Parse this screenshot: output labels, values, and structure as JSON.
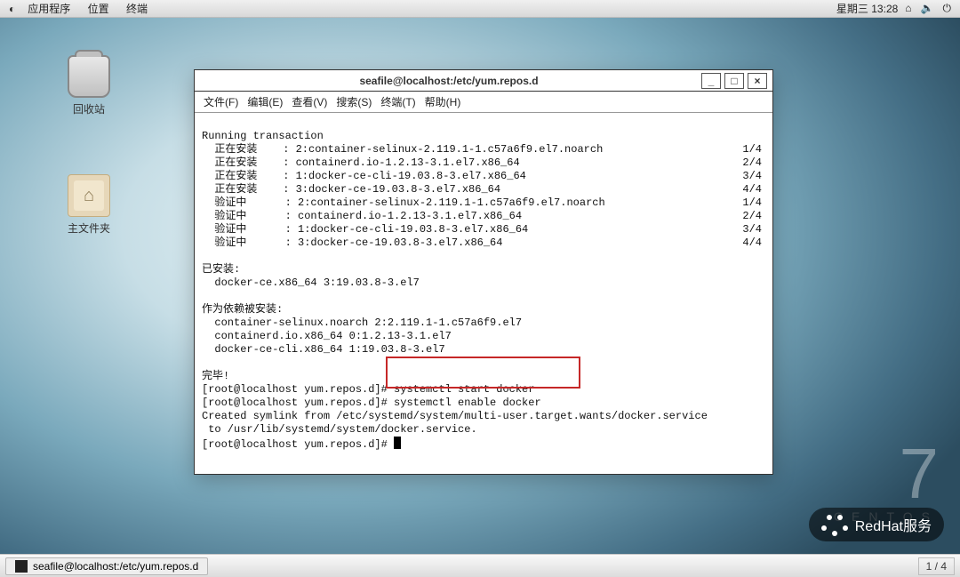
{
  "panel": {
    "menus": [
      "应用程序",
      "位置",
      "终端"
    ],
    "clock": "星期三 13:28",
    "tray_icons": [
      "network-icon",
      "sound-icon",
      "power-icon"
    ]
  },
  "desktop_icons": {
    "trash": "回收站",
    "home": "主文件夹"
  },
  "taskbar": {
    "task1": "seafile@localhost:/etc/yum.repos.d",
    "pager": "1 / 4"
  },
  "centos": {
    "big": "7",
    "word": "CENTOS"
  },
  "badge": "RedHat服务",
  "window": {
    "title": "seafile@localhost:/etc/yum.repos.d",
    "menus": [
      "文件(F)",
      "编辑(E)",
      "查看(V)",
      "搜索(S)",
      "终端(T)",
      "帮助(H)"
    ],
    "min": "_",
    "max": "□",
    "close": "×"
  },
  "term": {
    "l0": "Running transaction",
    "l1": "  正在安装    : 2:container-selinux-2.119.1-1.c57a6f9.el7.noarch",
    "r1": "1/4",
    "l2": "  正在安装    : containerd.io-1.2.13-3.1.el7.x86_64",
    "r2": "2/4",
    "l3": "  正在安装    : 1:docker-ce-cli-19.03.8-3.el7.x86_64",
    "r3": "3/4",
    "l4": "  正在安装    : 3:docker-ce-19.03.8-3.el7.x86_64",
    "r4": "4/4",
    "l5": "  验证中      : 2:container-selinux-2.119.1-1.c57a6f9.el7.noarch",
    "r5": "1/4",
    "l6": "  验证中      : containerd.io-1.2.13-3.1.el7.x86_64",
    "r6": "2/4",
    "l7": "  验证中      : 1:docker-ce-cli-19.03.8-3.el7.x86_64",
    "r7": "3/4",
    "l8": "  验证中      : 3:docker-ce-19.03.8-3.el7.x86_64",
    "r8": "4/4",
    "l9": "",
    "l10": "已安装:",
    "l11": "  docker-ce.x86_64 3:19.03.8-3.el7",
    "l12": "",
    "l13": "作为依赖被安装:",
    "l14": "  container-selinux.noarch 2:2.119.1-1.c57a6f9.el7",
    "l15": "  containerd.io.x86_64 0:1.2.13-3.1.el7",
    "l16": "  docker-ce-cli.x86_64 1:19.03.8-3.el7",
    "l17": "",
    "l18": "完毕!",
    "l19": "[root@localhost yum.repos.d]# systemctl start docker",
    "l20": "[root@localhost yum.repos.d]# systemctl enable docker",
    "l21": "Created symlink from /etc/systemd/system/multi-user.target.wants/docker.service",
    "l22": " to /usr/lib/systemd/system/docker.service.",
    "l23": "[root@localhost yum.repos.d]# "
  }
}
